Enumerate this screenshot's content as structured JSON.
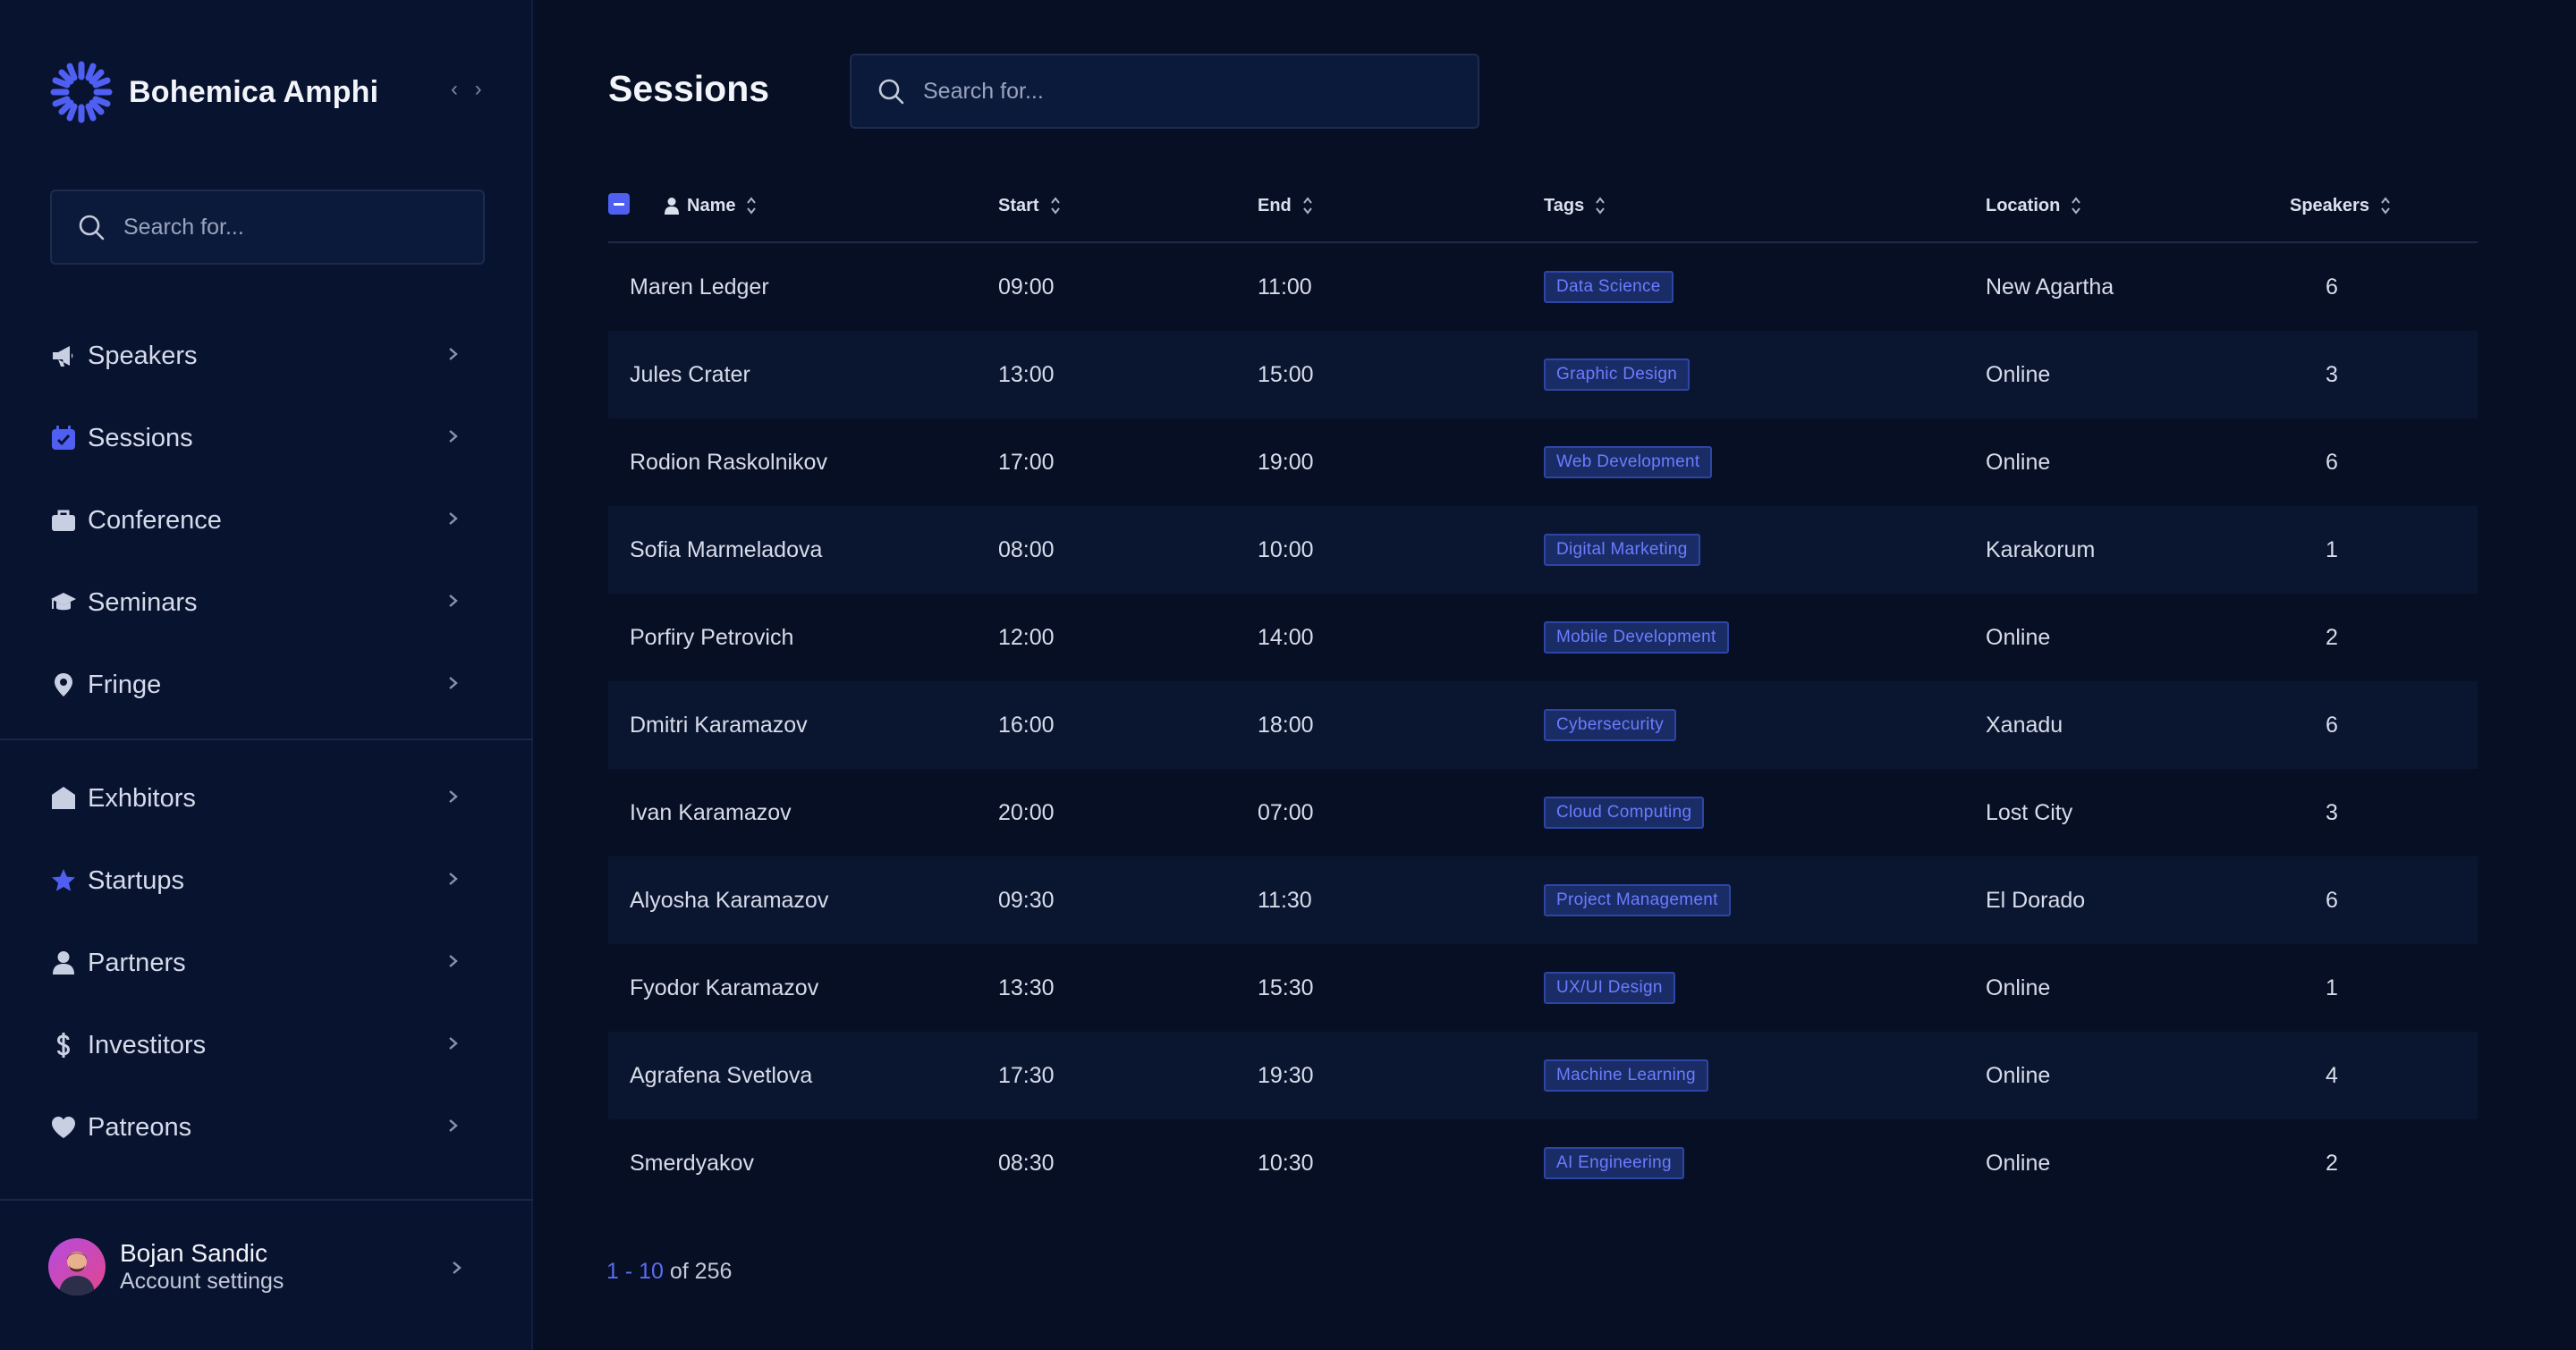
{
  "app": {
    "title": "Bohemica Amphi",
    "collapse_glyph": "‹ ›"
  },
  "sidebar": {
    "search": {
      "placeholder": "Search for..."
    },
    "primary_items": [
      {
        "label": "Speakers",
        "icon": "megaphone-icon"
      },
      {
        "label": "Sessions",
        "icon": "calendar-check-icon"
      },
      {
        "label": "Conference",
        "icon": "briefcase-icon"
      },
      {
        "label": "Seminars",
        "icon": "graduation-cap-icon"
      },
      {
        "label": "Fringe",
        "icon": "map-pin-icon"
      }
    ],
    "secondary_items": [
      {
        "label": "Exhbitors",
        "icon": "house-icon"
      },
      {
        "label": "Startups",
        "icon": "star-icon"
      },
      {
        "label": "Partners",
        "icon": "person-icon"
      },
      {
        "label": "Investitors",
        "icon": "dollar-icon"
      },
      {
        "label": "Patreons",
        "icon": "heart-icon"
      }
    ],
    "user": {
      "name": "Bojan Sandic",
      "subtitle": "Account settings"
    }
  },
  "main": {
    "title": "Sessions",
    "search": {
      "placeholder": "Search for..."
    },
    "table": {
      "columns": [
        "Name",
        "Start",
        "End",
        "Tags",
        "Location",
        "Speakers"
      ],
      "rows": [
        {
          "name": "Maren Ledger",
          "start": "09:00",
          "end": "11:00",
          "tag": "Data Science",
          "location": "New Agartha",
          "speakers": "6"
        },
        {
          "name": "Jules Crater",
          "start": "13:00",
          "end": "15:00",
          "tag": "Graphic Design",
          "location": "Online",
          "speakers": "3"
        },
        {
          "name": "Rodion Raskolnikov",
          "start": "17:00",
          "end": "19:00",
          "tag": "Web Development",
          "location": "Online",
          "speakers": "6"
        },
        {
          "name": "Sofia Marmeladova",
          "start": "08:00",
          "end": "10:00",
          "tag": "Digital Marketing",
          "location": "Karakorum",
          "speakers": "1"
        },
        {
          "name": "Porfiry Petrovich",
          "start": "12:00",
          "end": "14:00",
          "tag": "Mobile Development",
          "location": "Online",
          "speakers": "2"
        },
        {
          "name": "Dmitri Karamazov",
          "start": "16:00",
          "end": "18:00",
          "tag": "Cybersecurity",
          "location": "Xanadu",
          "speakers": "6"
        },
        {
          "name": "Ivan Karamazov",
          "start": "20:00",
          "end": "07:00",
          "tag": "Cloud Computing",
          "location": "Lost City",
          "speakers": "3"
        },
        {
          "name": "Alyosha Karamazov",
          "start": "09:30",
          "end": "11:30",
          "tag": "Project Management",
          "location": "El Dorado",
          "speakers": "6"
        },
        {
          "name": "Fyodor Karamazov",
          "start": "13:30",
          "end": "15:30",
          "tag": "UX/UI Design",
          "location": "Online",
          "speakers": "1"
        },
        {
          "name": "Agrafena Svetlova",
          "start": "17:30",
          "end": "19:30",
          "tag": "Machine Learning",
          "location": "Online",
          "speakers": "4"
        },
        {
          "name": "Smerdyakov",
          "start": "08:30",
          "end": "10:30",
          "tag": "AI Engineering",
          "location": "Online",
          "speakers": "2"
        }
      ]
    },
    "pagination": {
      "range": "1 - 10",
      "suffix": "of 256"
    }
  },
  "colors": {
    "background": "#070f24",
    "sidebar": "#081330",
    "accent": "#4f5ff2",
    "tag_text": "#6b7cff"
  }
}
